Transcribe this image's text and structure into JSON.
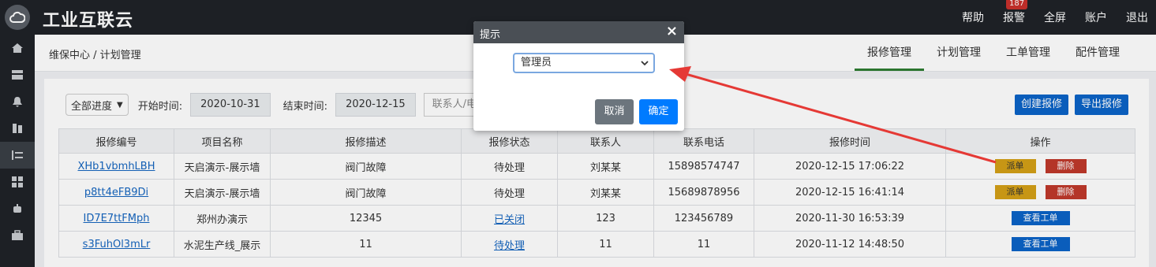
{
  "brand": "工业互联云",
  "topnav": {
    "help": "帮助",
    "alarm": "报警",
    "alarm_count": "187",
    "fullscreen": "全屏",
    "account": "账户",
    "logout": "退出"
  },
  "breadcrumb": "维保中心 / 计划管理",
  "tabs": [
    "报修管理",
    "计划管理",
    "工单管理",
    "配件管理"
  ],
  "filter": {
    "progress": "全部进度",
    "start_label": "开始时间:",
    "start_date": "2020-10-31",
    "end_label": "结束时间:",
    "end_date": "2020-12-15",
    "search_placeholder": "联系人/电话"
  },
  "actions": {
    "create": "创建报修",
    "export": "导出报修"
  },
  "table": {
    "headers": [
      "报修编号",
      "项目名称",
      "报修描述",
      "报修状态",
      "联系人",
      "联系电话",
      "报修时间",
      "操作"
    ],
    "rows": [
      {
        "id": "XHb1vbmhLBH",
        "project": "天启演示-展示墙",
        "desc": "阀门故障",
        "status": "待处理",
        "contact": "刘某某",
        "phone": "15898574747",
        "time": "2020-12-15 17:06:22",
        "op1": "派单",
        "op2": "删除"
      },
      {
        "id": "p8tt4eFB9Di",
        "project": "天启演示-展示墙",
        "desc": "阀门故障",
        "status": "待处理",
        "contact": "刘某某",
        "phone": "15689878956",
        "time": "2020-12-15 16:41:14",
        "op1": "派单",
        "op2": "删除"
      },
      {
        "id": "ID7E7ttFMph",
        "project": "郑州办演示",
        "desc": "12345",
        "status": "已关闭",
        "contact": "123",
        "phone": "123456789",
        "time": "2020-11-30 16:53:39",
        "op1": "查看工单"
      },
      {
        "id": "s3FuhOl3mLr",
        "project": "水泥生产线_展示",
        "desc": "11",
        "status": "待处理",
        "contact": "11",
        "phone": "11",
        "time": "2020-11-12 14:48:50",
        "op1": "查看工单"
      }
    ]
  },
  "modal": {
    "title": "提示",
    "select_value": "管理员",
    "cancel": "取消",
    "ok": "确定"
  },
  "colors": {
    "arrow": "#e53935",
    "primary": "#007bff",
    "topbar": "#1f2328"
  }
}
